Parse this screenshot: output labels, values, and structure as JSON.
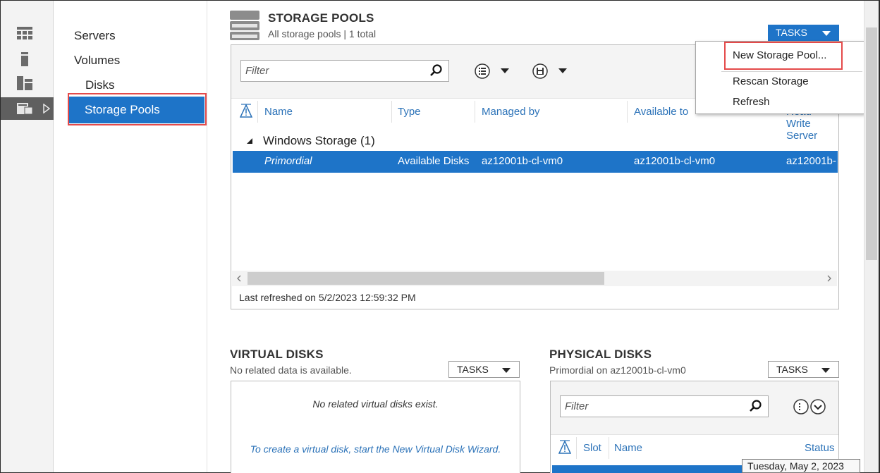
{
  "nav": {
    "items": [
      {
        "label": "Servers"
      },
      {
        "label": "Volumes"
      },
      {
        "label": "Disks"
      },
      {
        "label": "Storage Pools"
      }
    ]
  },
  "storage_pools": {
    "title": "STORAGE POOLS",
    "subtitle": "All storage pools | 1 total",
    "tasks_label": "TASKS",
    "filter_placeholder": "Filter",
    "columns": [
      "Name",
      "Type",
      "Managed by",
      "Available to",
      "Read-Write Server"
    ],
    "group": {
      "label": "Windows Storage (1)"
    },
    "rows": [
      {
        "name": "Primordial",
        "type": "Available Disks",
        "managed_by": "az12001b-cl-vm0",
        "available_to": "az12001b-cl-vm0",
        "rw_server": "az12001b-"
      }
    ],
    "last_refreshed": "Last refreshed on 5/2/2023 12:59:32 PM"
  },
  "tasks_menu": {
    "items": [
      "New Storage Pool...",
      "Rescan Storage",
      "Refresh"
    ]
  },
  "virtual_disks": {
    "title": "VIRTUAL DISKS",
    "subtitle": "No related data is available.",
    "tasks_label": "TASKS",
    "empty_note": "No related virtual disks exist.",
    "wizard_link": "To create a virtual disk, start the New Virtual Disk Wizard."
  },
  "physical_disks": {
    "title": "PHYSICAL DISKS",
    "subtitle": "Primordial on az12001b-cl-vm0",
    "tasks_label": "TASKS",
    "filter_placeholder": "Filter",
    "columns": [
      "Slot",
      "Name",
      "Status"
    ]
  },
  "tooltip": "Tuesday, May 2, 2023",
  "colors": {
    "accent": "#1e74c8",
    "highlight_box": "#e44a4a",
    "link": "#2b72b8"
  }
}
